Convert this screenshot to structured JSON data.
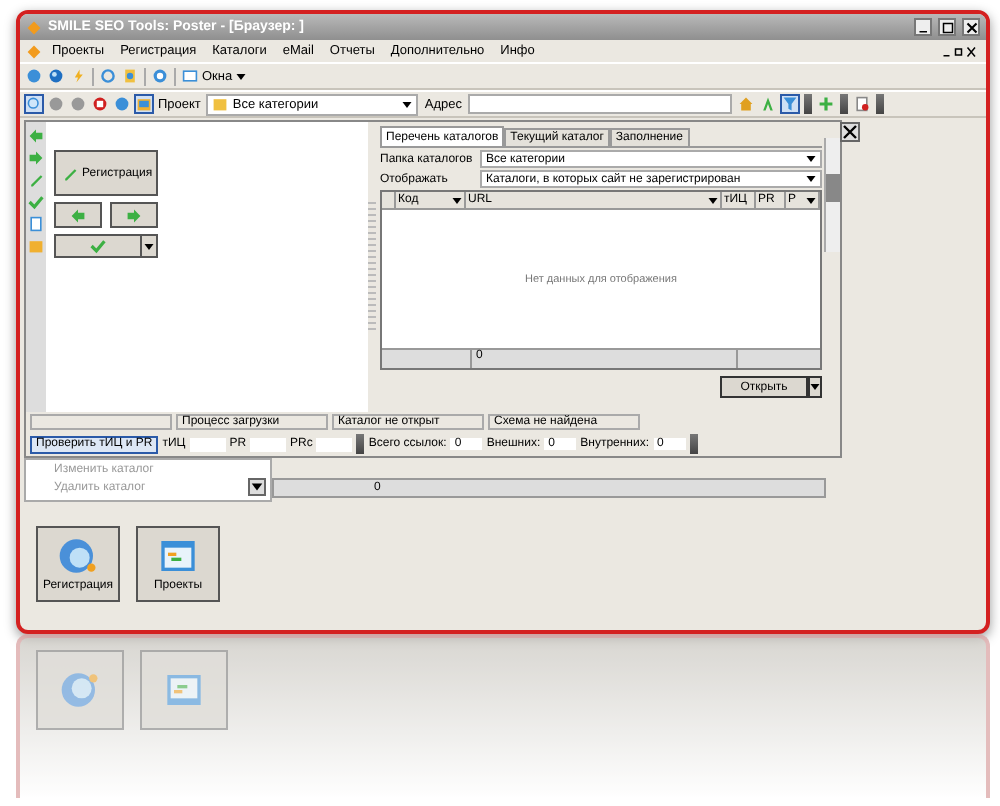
{
  "window": {
    "title": "SMILE SEO Tools: Poster - [Браузер: ]"
  },
  "menu": [
    "Проекты",
    "Регистрация",
    "Каталоги",
    "eMail",
    "Отчеты",
    "Дополнительно",
    "Инфо"
  ],
  "toolbar": {
    "windows_button": "Окна"
  },
  "address_bar": {
    "project_label": "Проект",
    "project_value": "Все категории",
    "address_label": "Адрес",
    "filter_selected": true
  },
  "left_panel": {
    "register_button": "Регистрация"
  },
  "tabs": [
    {
      "label": "Перечень каталогов",
      "selected": true
    },
    {
      "label": "Текущий каталог",
      "selected": false
    },
    {
      "label": "Заполнение",
      "selected": false
    }
  ],
  "filters": [
    {
      "label": "Папка каталогов",
      "value": "Все категории"
    },
    {
      "label": "Отображать",
      "value": "Каталоги, в которых сайт не зарегистрирован"
    }
  ],
  "table": {
    "columns": [
      "Код",
      "URL",
      "тИЦ",
      "PR",
      "P"
    ],
    "empty_text": "Нет данных для отображения",
    "footer_count": "0"
  },
  "open_button": "Открыть",
  "status_bar": [
    "Процесс загрузки",
    "Каталог не открыт",
    "Схема не найдена"
  ],
  "check_bar": {
    "button": "Проверить тИЦ и PR",
    "fields": [
      {
        "label": "тИЦ"
      },
      {
        "label": "PR"
      },
      {
        "label": "PRc"
      }
    ],
    "counts": [
      {
        "label": "Всего ссылок:",
        "value": "0"
      },
      {
        "label": "Внешних:",
        "value": "0"
      },
      {
        "label": "Внутренних:",
        "value": "0"
      }
    ]
  },
  "context_menu": [
    {
      "label": "Изменить каталог",
      "disabled": true
    },
    {
      "label": "Удалить каталог",
      "disabled": true
    }
  ],
  "lower_grid": {
    "footer_count": "0"
  },
  "big_buttons": [
    {
      "label": "Регистрация",
      "kind": "globe"
    },
    {
      "label": "Проекты",
      "kind": "table"
    }
  ],
  "reflection": [
    {
      "kind": "globe"
    },
    {
      "kind": "table"
    }
  ]
}
